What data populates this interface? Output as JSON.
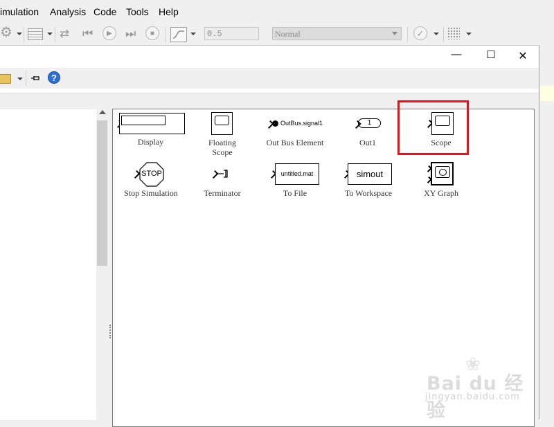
{
  "main_window": {
    "menu": [
      "imulation",
      "Analysis",
      "Code",
      "Tools",
      "Help"
    ],
    "toolbar": {
      "stop_time": "0.5",
      "simulation_mode": "Normal",
      "icons": [
        "gear-icon",
        "model-config-icon",
        "step-back-icon",
        "run-icon",
        "step-forward-icon",
        "stop-icon",
        "signal-viewer-icon",
        "check-icon",
        "dashboard-icon"
      ]
    }
  },
  "library_browser": {
    "window_controls": {
      "minimize": "—",
      "maximize": "☐",
      "close": "✕"
    },
    "toolbar_icons": [
      "folder-icon",
      "pin-icon",
      "help-icon"
    ],
    "help_glyph": "?",
    "blocks": [
      {
        "id": "display",
        "label": "Display"
      },
      {
        "id": "floating-scope",
        "label": "Floating\nScope"
      },
      {
        "id": "out-bus-element",
        "label": "Out Bus Element",
        "icon_text": "OutBus.signal1"
      },
      {
        "id": "out1",
        "label": "Out1",
        "icon_text": "1"
      },
      {
        "id": "scope",
        "label": "Scope",
        "highlighted": true
      },
      {
        "id": "stop-simulation",
        "label": "Stop Simulation",
        "icon_text": "STOP"
      },
      {
        "id": "terminator",
        "label": "Terminator"
      },
      {
        "id": "to-file",
        "label": "To File",
        "icon_text": "untitled.mat"
      },
      {
        "id": "to-workspace",
        "label": "To Workspace",
        "icon_text": "simout"
      },
      {
        "id": "xy-graph",
        "label": "XY Graph"
      }
    ],
    "highlight_color": "#e0141e"
  },
  "watermark": {
    "brand": "Bai du 经验",
    "url": "jingyan.baidu.com"
  }
}
